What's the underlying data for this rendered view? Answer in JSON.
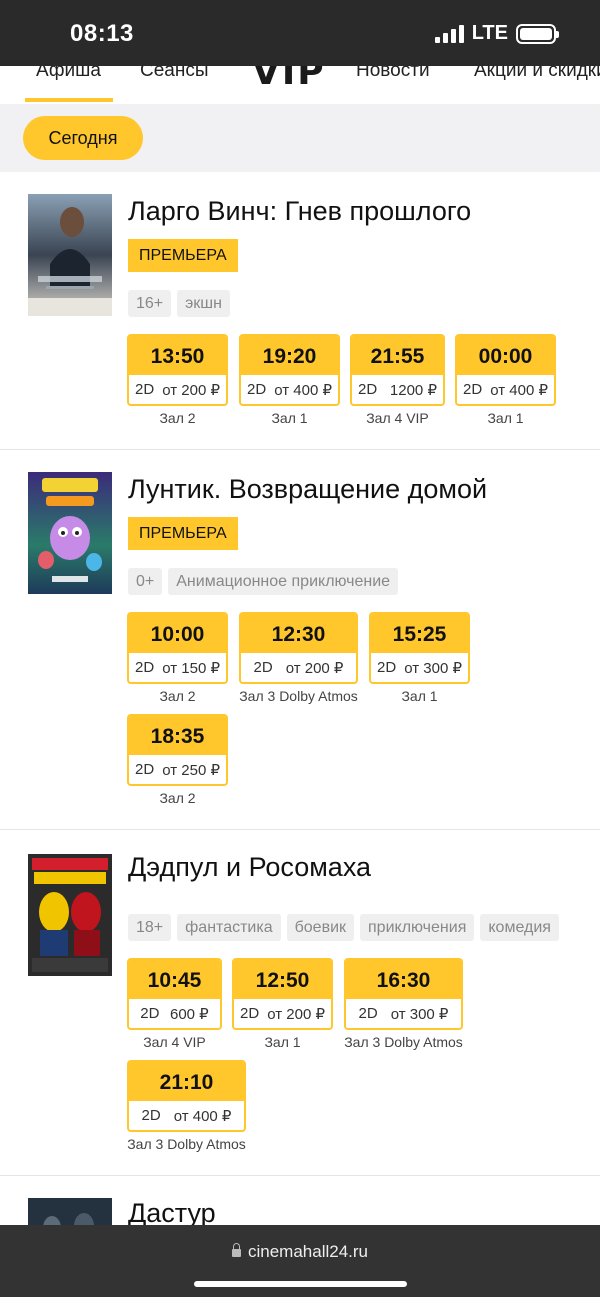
{
  "status": {
    "time": "08:13",
    "network": "LTE"
  },
  "nav": {
    "items": [
      "Афиша",
      "Сеансы",
      "Новости",
      "Акции и скидки"
    ],
    "logo": "VIP"
  },
  "filter": {
    "today": "Сегодня"
  },
  "movies": [
    {
      "title": "Ларго Винч: Гнев прошлого",
      "premiere": "ПРЕМЬЕРА",
      "tags": [
        "16+",
        "экшн"
      ],
      "sessions": [
        {
          "time": "13:50",
          "format": "2D",
          "price": "от 200 ₽",
          "hall": "Зал 2"
        },
        {
          "time": "19:20",
          "format": "2D",
          "price": "от 400 ₽",
          "hall": "Зал 1"
        },
        {
          "time": "21:55",
          "format": "2D",
          "price": "1200 ₽",
          "hall": "Зал 4 VIP"
        },
        {
          "time": "00:00",
          "format": "2D",
          "price": "от 400 ₽",
          "hall": "Зал 1"
        }
      ]
    },
    {
      "title": "Лунтик. Возвращение домой",
      "premiere": "ПРЕМЬЕРА",
      "tags": [
        "0+",
        "Анимационное приключение"
      ],
      "sessions": [
        {
          "time": "10:00",
          "format": "2D",
          "price": "от 150 ₽",
          "hall": "Зал 2"
        },
        {
          "time": "12:30",
          "format": "2D",
          "price": "от 200 ₽",
          "hall": "Зал 3 Dolby Atmos"
        },
        {
          "time": "15:25",
          "format": "2D",
          "price": "от 300 ₽",
          "hall": "Зал 1"
        },
        {
          "time": "18:35",
          "format": "2D",
          "price": "от 250 ₽",
          "hall": "Зал 2"
        }
      ]
    },
    {
      "title": "Дэдпул и Росомаха",
      "tags": [
        "18+",
        "фантастика",
        "боевик",
        "приключения",
        "комедия"
      ],
      "sessions": [
        {
          "time": "10:45",
          "format": "2D",
          "price": "600 ₽",
          "hall": "Зал 4 VIP"
        },
        {
          "time": "12:50",
          "format": "2D",
          "price": "от 200 ₽",
          "hall": "Зал 1"
        },
        {
          "time": "16:30",
          "format": "2D",
          "price": "от 300 ₽",
          "hall": "Зал 3 Dolby Atmos"
        },
        {
          "time": "21:10",
          "format": "2D",
          "price": "от 400 ₽",
          "hall": "Зал 3 Dolby Atmos"
        }
      ]
    },
    {
      "title": "Дастур"
    }
  ],
  "browser": {
    "url": "cinemahall24.ru"
  },
  "colors": {
    "accent": "#ffc72c",
    "tag_bg": "#efefef",
    "bar_dark": "#2a2a2a"
  }
}
